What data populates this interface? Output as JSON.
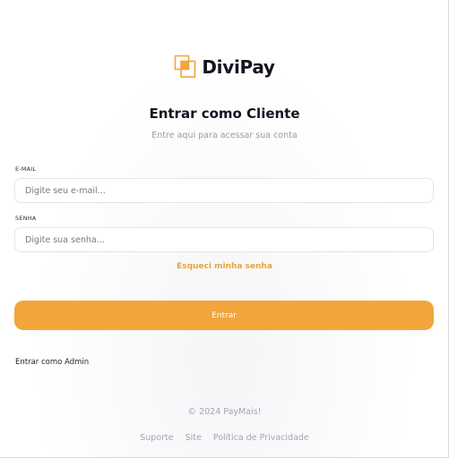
{
  "brand": {
    "name": "DiviPay",
    "logo_icon": "overlapping-squares-logo",
    "accent_color": "#f2a53a"
  },
  "header": {
    "title": "Entrar como Cliente",
    "subtitle": "Entre aqui para acessar sua conta"
  },
  "form": {
    "email_label": "E-MAIL",
    "email_placeholder": "Digite seu e-mail...",
    "email_value": "",
    "password_label": "SENHA",
    "password_placeholder": "Digite sua senha...",
    "password_value": "",
    "forgot_label": "Esqueci minha senha",
    "submit_label": "Entrar"
  },
  "admin_link": "Entrar como Admin",
  "footer": {
    "copyright": "© 2024 PayMais!",
    "links": [
      "Suporte",
      "Site",
      "Política de Privacidade"
    ]
  }
}
